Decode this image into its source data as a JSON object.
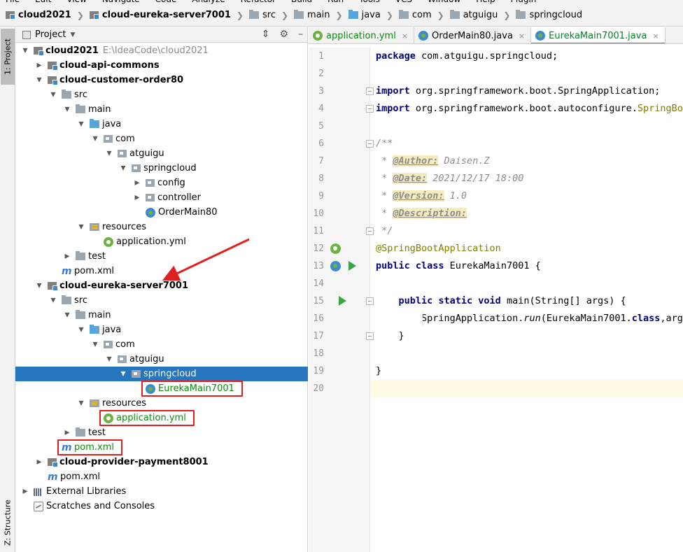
{
  "menu": [
    "File",
    "Edit",
    "View",
    "Navigate",
    "Code",
    "Analyze",
    "Refactor",
    "Build",
    "Run",
    "Tools",
    "VCS",
    "Window",
    "Help",
    "Plugin"
  ],
  "breadcrumb": [
    {
      "label": "cloud2021",
      "kind": "module",
      "bold": true
    },
    {
      "label": "cloud-eureka-server7001",
      "kind": "module",
      "bold": true
    },
    {
      "label": "src",
      "kind": "folder"
    },
    {
      "label": "main",
      "kind": "folder"
    },
    {
      "label": "java",
      "kind": "folder-blue"
    },
    {
      "label": "com",
      "kind": "folder"
    },
    {
      "label": "atguigu",
      "kind": "folder"
    },
    {
      "label": "springcloud",
      "kind": "folder"
    }
  ],
  "toolstripe": {
    "project": "1: Project",
    "structure": "Z: Structure"
  },
  "project_panel": {
    "title": "Project",
    "tree": [
      {
        "depth": 0,
        "arrow": "down",
        "icon": "module",
        "label": "cloud2021",
        "bold": true,
        "path": "E:\\IdeaCode\\cloud2021"
      },
      {
        "depth": 1,
        "arrow": "right",
        "icon": "module",
        "label": "cloud-api-commons",
        "bold": true
      },
      {
        "depth": 1,
        "arrow": "down",
        "icon": "module",
        "label": "cloud-customer-order80",
        "bold": true
      },
      {
        "depth": 2,
        "arrow": "down",
        "icon": "folder",
        "label": "src"
      },
      {
        "depth": 3,
        "arrow": "down",
        "icon": "folder",
        "label": "main"
      },
      {
        "depth": 4,
        "arrow": "down",
        "icon": "folder-blue",
        "label": "java"
      },
      {
        "depth": 5,
        "arrow": "down",
        "icon": "package",
        "label": "com"
      },
      {
        "depth": 6,
        "arrow": "down",
        "icon": "package",
        "label": "atguigu"
      },
      {
        "depth": 7,
        "arrow": "down",
        "icon": "package",
        "label": "springcloud"
      },
      {
        "depth": 8,
        "arrow": "right",
        "icon": "package",
        "label": "config"
      },
      {
        "depth": 8,
        "arrow": "right",
        "icon": "package",
        "label": "controller"
      },
      {
        "depth": 8,
        "arrow": "none",
        "icon": "boot-class",
        "label": "OrderMain80"
      },
      {
        "depth": 4,
        "arrow": "down",
        "icon": "resources",
        "label": "resources"
      },
      {
        "depth": 5,
        "arrow": "none",
        "icon": "spring-yml",
        "label": "application.yml"
      },
      {
        "depth": 3,
        "arrow": "right",
        "icon": "folder",
        "label": "test"
      },
      {
        "depth": 2,
        "arrow": "none",
        "icon": "maven",
        "label": "pom.xml"
      },
      {
        "depth": 1,
        "arrow": "down",
        "icon": "module",
        "label": "cloud-eureka-server7001",
        "bold": true
      },
      {
        "depth": 2,
        "arrow": "down",
        "icon": "folder",
        "label": "src"
      },
      {
        "depth": 3,
        "arrow": "down",
        "icon": "folder",
        "label": "main"
      },
      {
        "depth": 4,
        "arrow": "down",
        "icon": "folder-blue",
        "label": "java"
      },
      {
        "depth": 5,
        "arrow": "down",
        "icon": "package",
        "label": "com"
      },
      {
        "depth": 6,
        "arrow": "down",
        "icon": "package",
        "label": "atguigu"
      },
      {
        "depth": 7,
        "arrow": "down",
        "icon": "package",
        "label": "springcloud",
        "selected": true
      },
      {
        "depth": 8,
        "arrow": "none",
        "icon": "boot-class",
        "label": "EurekaMain7001",
        "green": true,
        "boxed": true
      },
      {
        "depth": 4,
        "arrow": "down",
        "icon": "resources",
        "label": "resources"
      },
      {
        "depth": 5,
        "arrow": "none",
        "icon": "spring-yml",
        "label": "application.yml",
        "green": true,
        "boxed": true
      },
      {
        "depth": 3,
        "arrow": "right",
        "icon": "folder",
        "label": "test"
      },
      {
        "depth": 2,
        "arrow": "none",
        "icon": "maven",
        "label": "pom.xml",
        "green": true,
        "boxed": true
      },
      {
        "depth": 1,
        "arrow": "right",
        "icon": "module",
        "label": "cloud-provider-payment8001",
        "bold": true
      },
      {
        "depth": 1,
        "arrow": "none",
        "icon": "maven",
        "label": "pom.xml"
      },
      {
        "depth": 0,
        "arrow": "right",
        "icon": "library",
        "label": "External Libraries"
      },
      {
        "depth": 0,
        "arrow": "none",
        "icon": "scratch",
        "label": "Scratches and Consoles"
      }
    ]
  },
  "editor": {
    "tabs": [
      {
        "label": "application.yml",
        "icon": "spring-yml",
        "color": "green",
        "active": false
      },
      {
        "label": "OrderMain80.java",
        "icon": "boot-class",
        "color": "normal",
        "active": false
      },
      {
        "label": "EurekaMain7001.java",
        "icon": "boot-class",
        "color": "dkgreen",
        "active": true
      }
    ],
    "close_glyph": "×",
    "lines": [
      {
        "n": "1",
        "tokens": [
          {
            "t": "package",
            "c": "kw"
          },
          {
            "t": " com.atguigu.springcloud;",
            "c": ""
          }
        ]
      },
      {
        "n": "2",
        "tokens": []
      },
      {
        "n": "3",
        "tokens": [
          {
            "t": "import",
            "c": "kw"
          },
          {
            "t": " org.springframework.boot.SpringApplication;",
            "c": ""
          }
        ]
      },
      {
        "n": "4",
        "tokens": [
          {
            "t": "import",
            "c": "kw"
          },
          {
            "t": " org.springframework.boot.autoconfigure.",
            "c": ""
          },
          {
            "t": "SpringBoo",
            "c": "anno"
          }
        ]
      },
      {
        "n": "5",
        "tokens": []
      },
      {
        "n": "6",
        "tokens": [
          {
            "t": "/**",
            "c": "cmt"
          }
        ]
      },
      {
        "n": "7",
        "tokens": [
          {
            "t": " * ",
            "c": "cmt"
          },
          {
            "t": "@Author:",
            "c": "tag"
          },
          {
            "t": " Daisen.Z",
            "c": "cmt"
          }
        ]
      },
      {
        "n": "8",
        "tokens": [
          {
            "t": " * ",
            "c": "cmt"
          },
          {
            "t": "@Date:",
            "c": "tag"
          },
          {
            "t": " 2021/12/17 18:00",
            "c": "cmt"
          }
        ]
      },
      {
        "n": "9",
        "tokens": [
          {
            "t": " * ",
            "c": "cmt"
          },
          {
            "t": "@Version:",
            "c": "tag"
          },
          {
            "t": " 1.0",
            "c": "cmt"
          }
        ]
      },
      {
        "n": "10",
        "tokens": [
          {
            "t": " * ",
            "c": "cmt"
          },
          {
            "t": "@Description:",
            "c": "tag"
          }
        ]
      },
      {
        "n": "11",
        "tokens": [
          {
            "t": " */",
            "c": "cmt"
          }
        ]
      },
      {
        "n": "12",
        "tokens": [
          {
            "t": "@SpringBootApplication",
            "c": "anno"
          }
        ]
      },
      {
        "n": "13",
        "tokens": [
          {
            "t": "public class",
            "c": "kw"
          },
          {
            "t": " EurekaMain7001 {",
            "c": ""
          }
        ]
      },
      {
        "n": "14",
        "tokens": []
      },
      {
        "n": "15",
        "tokens": [
          {
            "t": "    ",
            "c": ""
          },
          {
            "t": "public static void",
            "c": "kw"
          },
          {
            "t": " main(String[] args) {",
            "c": ""
          }
        ]
      },
      {
        "n": "16",
        "tokens": [
          {
            "t": "        SpringApplication.",
            "c": ""
          },
          {
            "t": "run",
            "c": "ital"
          },
          {
            "t": "(EurekaMain7001.",
            "c": ""
          },
          {
            "t": "class",
            "c": "kw"
          },
          {
            "t": ",args",
            "c": ""
          }
        ]
      },
      {
        "n": "17",
        "tokens": [
          {
            "t": "    }",
            "c": ""
          }
        ]
      },
      {
        "n": "18",
        "tokens": []
      },
      {
        "n": "19",
        "tokens": [
          {
            "t": "}",
            "c": ""
          }
        ]
      },
      {
        "n": "20",
        "tokens": []
      }
    ],
    "current_line": "20"
  },
  "colors": {
    "selection": "#2675bf",
    "annotation_red": "#e02020",
    "green_modified": "#0f8a0f",
    "keyword": "#000080"
  }
}
